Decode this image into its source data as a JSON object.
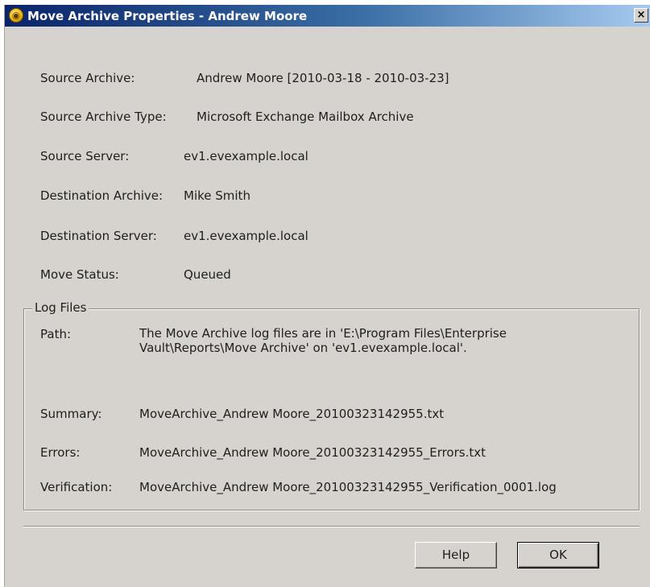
{
  "window": {
    "title": "Move Archive Properties - Andrew Moore",
    "icon": "enterprise-vault-icon",
    "close_glyph": "×"
  },
  "properties": [
    {
      "label": "Source Archive:",
      "value": "Andrew Moore [2010-03-18 - 2010-03-23]"
    },
    {
      "label": "Source Archive Type:",
      "value": "Microsoft Exchange Mailbox Archive"
    },
    {
      "label": "Source Server:",
      "value": "ev1.evexample.local"
    },
    {
      "label": "Destination Archive:",
      "value": "Mike Smith"
    },
    {
      "label": "Destination Server:",
      "value": "ev1.evexample.local"
    },
    {
      "label": "Move Status:",
      "value": "Queued"
    }
  ],
  "log_files": {
    "title": "Log Files",
    "path_label": "Path:",
    "path_value": "The Move Archive log files are in 'E:\\Program Files\\Enterprise Vault\\Reports\\Move Archive' on 'ev1.evexample.local'.",
    "summary_label": "Summary:",
    "summary_value": "MoveArchive_Andrew Moore_20100323142955.txt",
    "errors_label": "Errors:",
    "errors_value": "MoveArchive_Andrew Moore_20100323142955_Errors.txt",
    "verification_label": "Verification:",
    "verification_value": "MoveArchive_Andrew Moore_20100323142955_Verification_0001.log"
  },
  "buttons": {
    "help_label": "Help",
    "ok_label": "OK"
  },
  "colors": {
    "title_bar_start": "#0a246a",
    "title_bar_end": "#a6caf0",
    "dialog_face": "#d6d3ce"
  }
}
